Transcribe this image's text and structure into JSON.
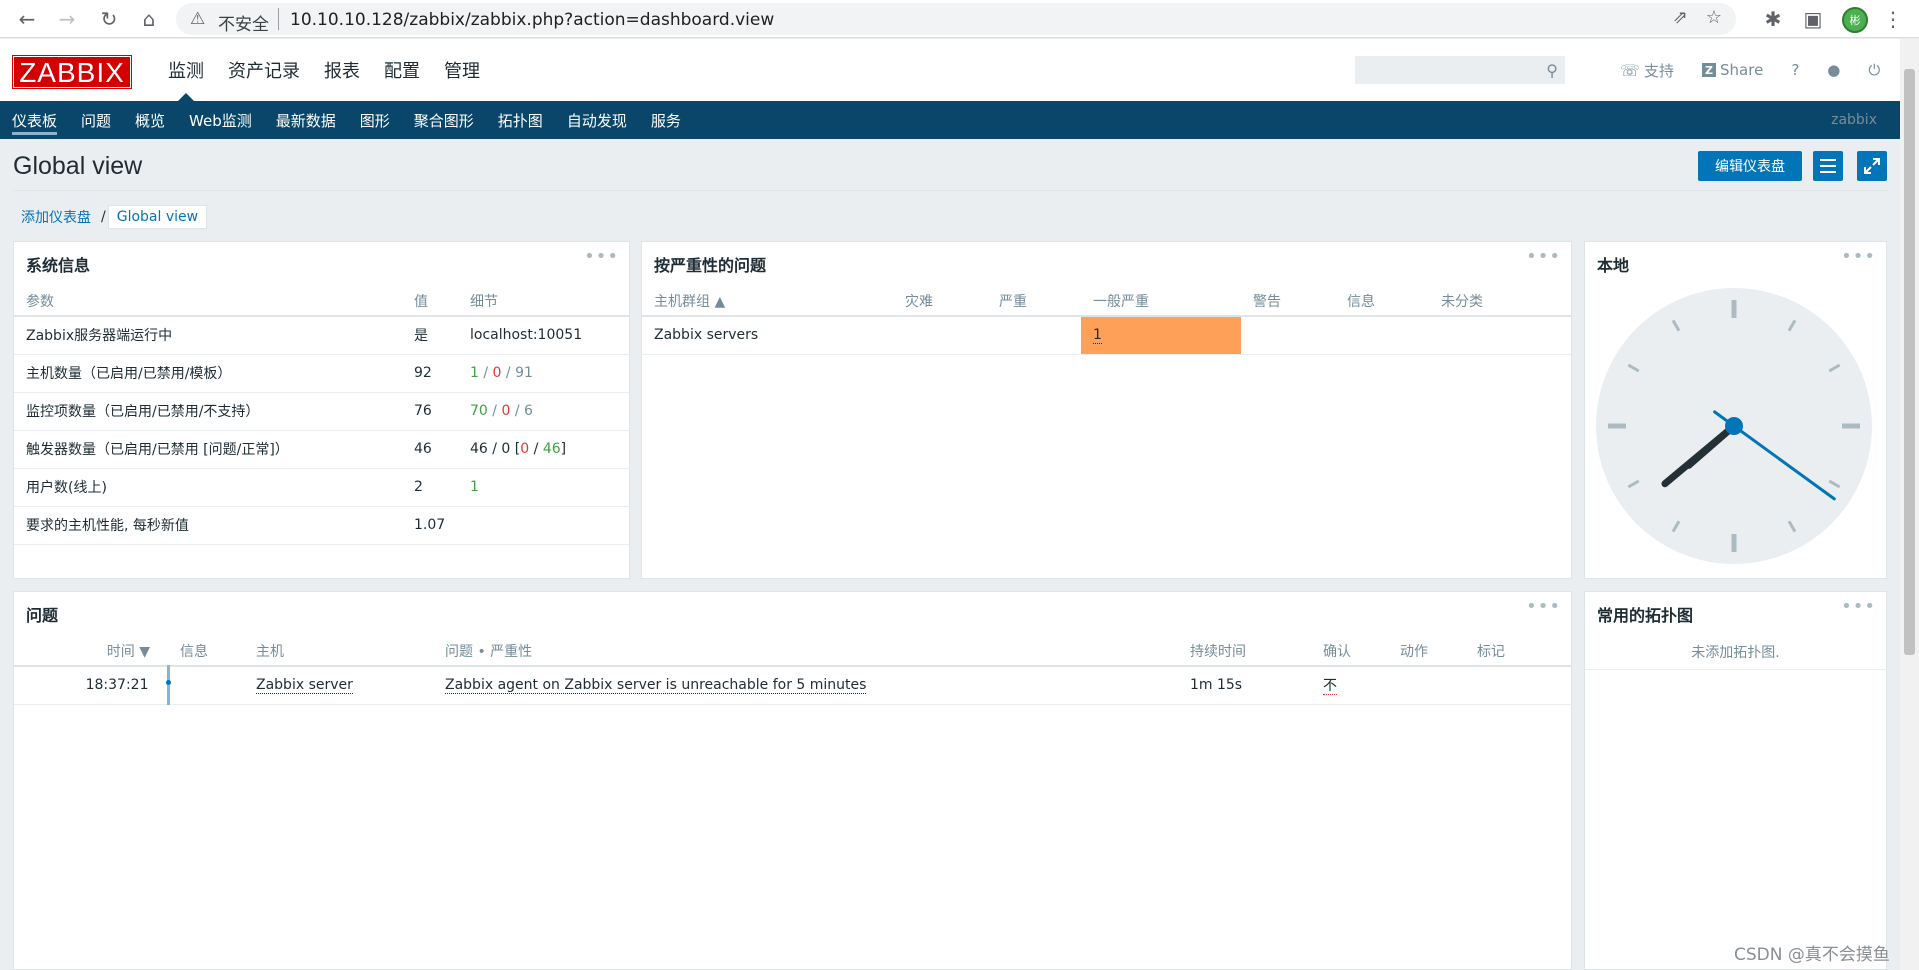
{
  "browser": {
    "insecure_label": "不安全",
    "url": "10.10.10.128/zabbix/zabbix.php?action=dashboard.view",
    "avatar_text": "彬"
  },
  "header": {
    "logo": "ZABBIX",
    "menu": [
      "监测",
      "资产记录",
      "报表",
      "配置",
      "管理"
    ],
    "active_menu_index": 0,
    "search_value": "",
    "support_label": "支持",
    "share_label": "Share",
    "help_label": "?"
  },
  "subnav": {
    "items": [
      "仪表板",
      "问题",
      "概览",
      "Web监测",
      "最新数据",
      "图形",
      "聚合图形",
      "拓扑图",
      "自动发现",
      "服务"
    ],
    "active_index": 0,
    "brand": "zabbix"
  },
  "page": {
    "title": "Global view",
    "edit_button": "编辑仪表盘"
  },
  "breadcrumb": {
    "parent": "添加仪表盘",
    "separator": "/",
    "current": "Global view"
  },
  "system_info": {
    "title": "系统信息",
    "columns": [
      "参数",
      "值",
      "细节"
    ],
    "rows": [
      {
        "param": "Zabbix服务器端运行中",
        "value": "是",
        "details": [
          {
            "text": "localhost:10051",
            "color": "default"
          }
        ]
      },
      {
        "param": "主机数量（已启用/已禁用/模板）",
        "value": "92",
        "details": [
          {
            "text": "1",
            "color": "green"
          },
          {
            "text": " / ",
            "color": "grey"
          },
          {
            "text": "0",
            "color": "red"
          },
          {
            "text": " / ",
            "color": "grey"
          },
          {
            "text": "91",
            "color": "grey"
          }
        ]
      },
      {
        "param": "监控项数量（已启用/已禁用/不支持）",
        "value": "76",
        "details": [
          {
            "text": "70",
            "color": "green"
          },
          {
            "text": " / ",
            "color": "grey"
          },
          {
            "text": "0",
            "color": "red"
          },
          {
            "text": " / ",
            "color": "grey"
          },
          {
            "text": "6",
            "color": "grey"
          }
        ]
      },
      {
        "param": "触发器数量（已启用/已禁用 [问题/正常]）",
        "value": "46",
        "details": [
          {
            "text": "46 / 0 [",
            "color": "default"
          },
          {
            "text": "0",
            "color": "red"
          },
          {
            "text": " / ",
            "color": "default"
          },
          {
            "text": "46",
            "color": "green"
          },
          {
            "text": "]",
            "color": "default"
          }
        ]
      },
      {
        "param": "用户数(线上)",
        "value": "2",
        "details": [
          {
            "text": "1",
            "color": "green"
          }
        ]
      },
      {
        "param": "要求的主机性能, 每秒新值",
        "value": "1.07",
        "details": []
      }
    ]
  },
  "problems_by_severity": {
    "title": "按严重性的问题",
    "columns": [
      "主机群组 ▲",
      "灾难",
      "严重",
      "一般严重",
      "警告",
      "信息",
      "未分类"
    ],
    "rows": [
      {
        "group": "Zabbix servers",
        "disaster": "",
        "high": "",
        "average": "1",
        "warning": "",
        "info": "",
        "not_classified": ""
      }
    ],
    "average_color": "#ffa059"
  },
  "clock": {
    "title": "本地",
    "hour": 7,
    "minute": 38,
    "second": 21
  },
  "problems": {
    "title": "问题",
    "columns": [
      "时间 ▼",
      "信息",
      "主机",
      "问题 • 严重性",
      "持续时间",
      "确认",
      "动作",
      "标记"
    ],
    "rows": [
      {
        "time": "18:37:21",
        "info": "",
        "host": "Zabbix server",
        "problem": "Zabbix agent on Zabbix server is unreachable for 5 minutes",
        "duration": "1m 15s",
        "ack": "不",
        "actions": "",
        "tags": ""
      }
    ]
  },
  "favorite_maps": {
    "title": "常用的拓扑图",
    "empty_text": "未添加拓扑图."
  },
  "watermark": "CSDN @真不会摸鱼",
  "colors": {
    "brand_red": "#d40000",
    "nav_blue": "#0a466a",
    "button_blue": "#0275b8",
    "severity_average": "#ffa059",
    "ok_green": "#429e47",
    "problem_red": "#e33734"
  }
}
